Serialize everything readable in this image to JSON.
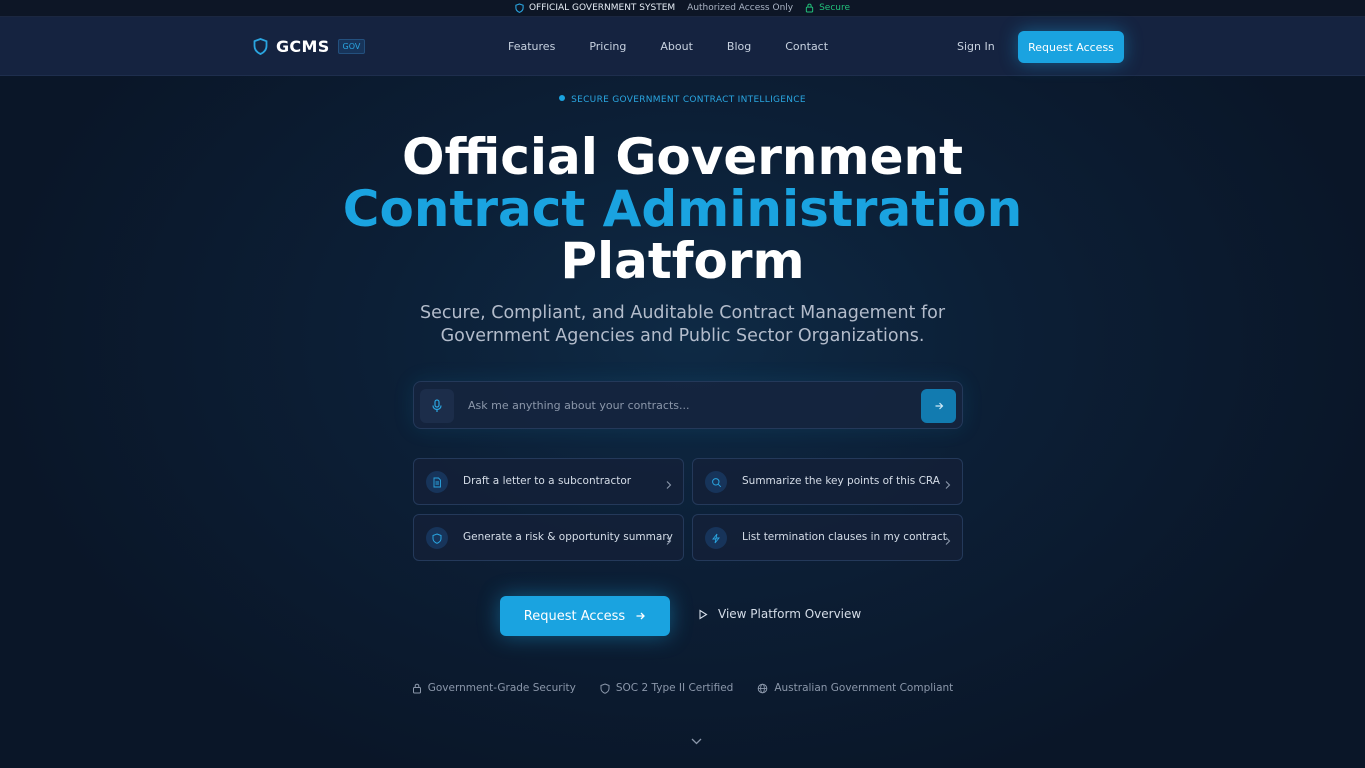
{
  "topstrip": {
    "official": "OFFICIAL GOVERNMENT SYSTEM",
    "authorized": "Authorized Access Only",
    "secure": "Secure"
  },
  "nav": {
    "brand": "GCMS",
    "brand_tag": "GOV",
    "links": [
      "Features",
      "Pricing",
      "About",
      "Blog",
      "Contact"
    ],
    "signin": "Sign In",
    "request": "Request Access"
  },
  "hero": {
    "eyebrow": "SECURE GOVERNMENT CONTRACT INTELLIGENCE",
    "title_line1": "Official Government",
    "title_line2": "Contract Administration",
    "title_line3": "Platform",
    "subtitle_line1": "Secure, Compliant, and Auditable Contract Management for",
    "subtitle_line2": "Government Agencies and Public Sector Organizations."
  },
  "search": {
    "placeholder": "Ask me anything about your contracts..."
  },
  "suggestions": [
    {
      "label": "Draft a letter to a subcontractor",
      "icon": "document-icon"
    },
    {
      "label": "Summarize the key points of this CRA",
      "icon": "search-icon"
    },
    {
      "label": "Generate a risk & opportunity summary",
      "icon": "shield-icon"
    },
    {
      "label": "List termination clauses in my contract",
      "icon": "lightning-icon"
    }
  ],
  "cta": {
    "primary": "Request Access",
    "secondary": "View Platform Overview"
  },
  "badges": [
    "Government-Grade Security",
    "SOC 2 Type II Certified",
    "Australian Government Compliant"
  ],
  "colors": {
    "accent": "#1aa3e0",
    "background": "#0a1628",
    "secure_green": "#22c07a"
  }
}
